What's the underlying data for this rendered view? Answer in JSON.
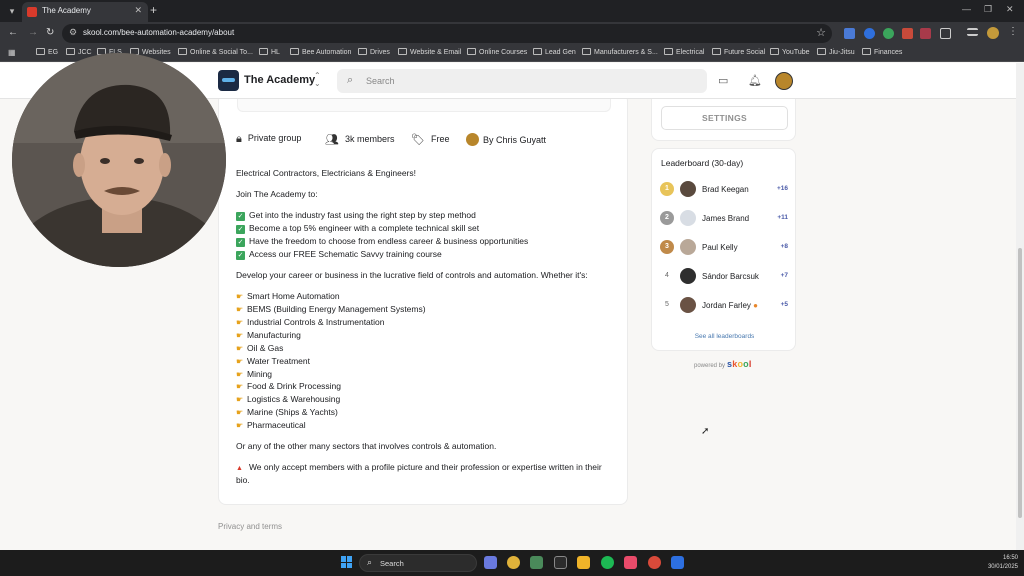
{
  "browser": {
    "tab_title": "The Academy",
    "url": "skool.com/bee-automation-academy/about",
    "bookmarks": [
      "EG",
      "JCC",
      "FLS",
      "Websites",
      "Online & Social To...",
      "HL",
      "Bee Automation",
      "Drives",
      "Website & Email",
      "Online Courses",
      "Lead Gen",
      "Manufacturers & S...",
      "Electrical",
      "Future Social",
      "YouTube",
      "Jiu-Jitsu",
      "Finances"
    ]
  },
  "header": {
    "brand": "The Academy",
    "search_placeholder": "Search"
  },
  "group_meta": {
    "privacy": "Private group",
    "members": "3k members",
    "price": "Free",
    "owner": "By Chris Guyatt"
  },
  "about": {
    "intro": "Electrical Contractors, Electricians & Engineers!",
    "join": "Join The Academy to:",
    "benefits": [
      "Get into the industry fast using the right step by step method",
      "Become a top 5% engineer with a complete technical skill set",
      "Have the freedom to choose from endless career & business opportunities",
      "Access our FREE Schematic Savvy training course"
    ],
    "develop": "Develop your career or business in the lucrative field of controls and automation. Whether it's:",
    "sectors": [
      "Smart Home Automation",
      "BEMS (Building Energy Management Systems)",
      "Industrial Controls & Instrumentation",
      "Manufacturing",
      "Oil & Gas",
      "Water Treatment",
      "Mining",
      "Food & Drink Processing",
      "Logistics & Warehousing",
      "Marine (Ships & Yachts)",
      "Pharmaceutical"
    ],
    "other": "Or any of the other many sectors that involves controls & automation.",
    "notice_line1": "We only accept members with a profile picture and their profession or expertise written in their",
    "notice_line2": "bio."
  },
  "sidebar": {
    "settings_label": "SETTINGS",
    "leaderboard_title": "Leaderboard (30-day)",
    "leaders": [
      {
        "rank": "1",
        "name": "Brad Keegan",
        "points": "+16"
      },
      {
        "rank": "2",
        "name": "James Brand",
        "points": "+11"
      },
      {
        "rank": "3",
        "name": "Paul Kelly",
        "points": "+8"
      },
      {
        "rank": "4",
        "name": "Sándor Barcsuk",
        "points": "+7"
      },
      {
        "rank": "5",
        "name": "Jordan Farley",
        "points": "+5"
      }
    ],
    "see_all": "See all leaderboards",
    "powered_by": "powered by",
    "powered_brand": "skool"
  },
  "footer": {
    "privacy_terms": "Privacy and terms"
  },
  "taskbar": {
    "search_label": "Search",
    "time": "16:50",
    "date": "30/01/2025"
  },
  "colors": {
    "skool_brand": [
      "#2e56a6",
      "#e8542e",
      "#f2b632",
      "#3ba55c",
      "#d93a2b"
    ],
    "medal_gold": "#e8c45a",
    "medal_silver": "#9a9a9a",
    "medal_bronze": "#c08a4a",
    "check_green": "#3ba55c"
  }
}
